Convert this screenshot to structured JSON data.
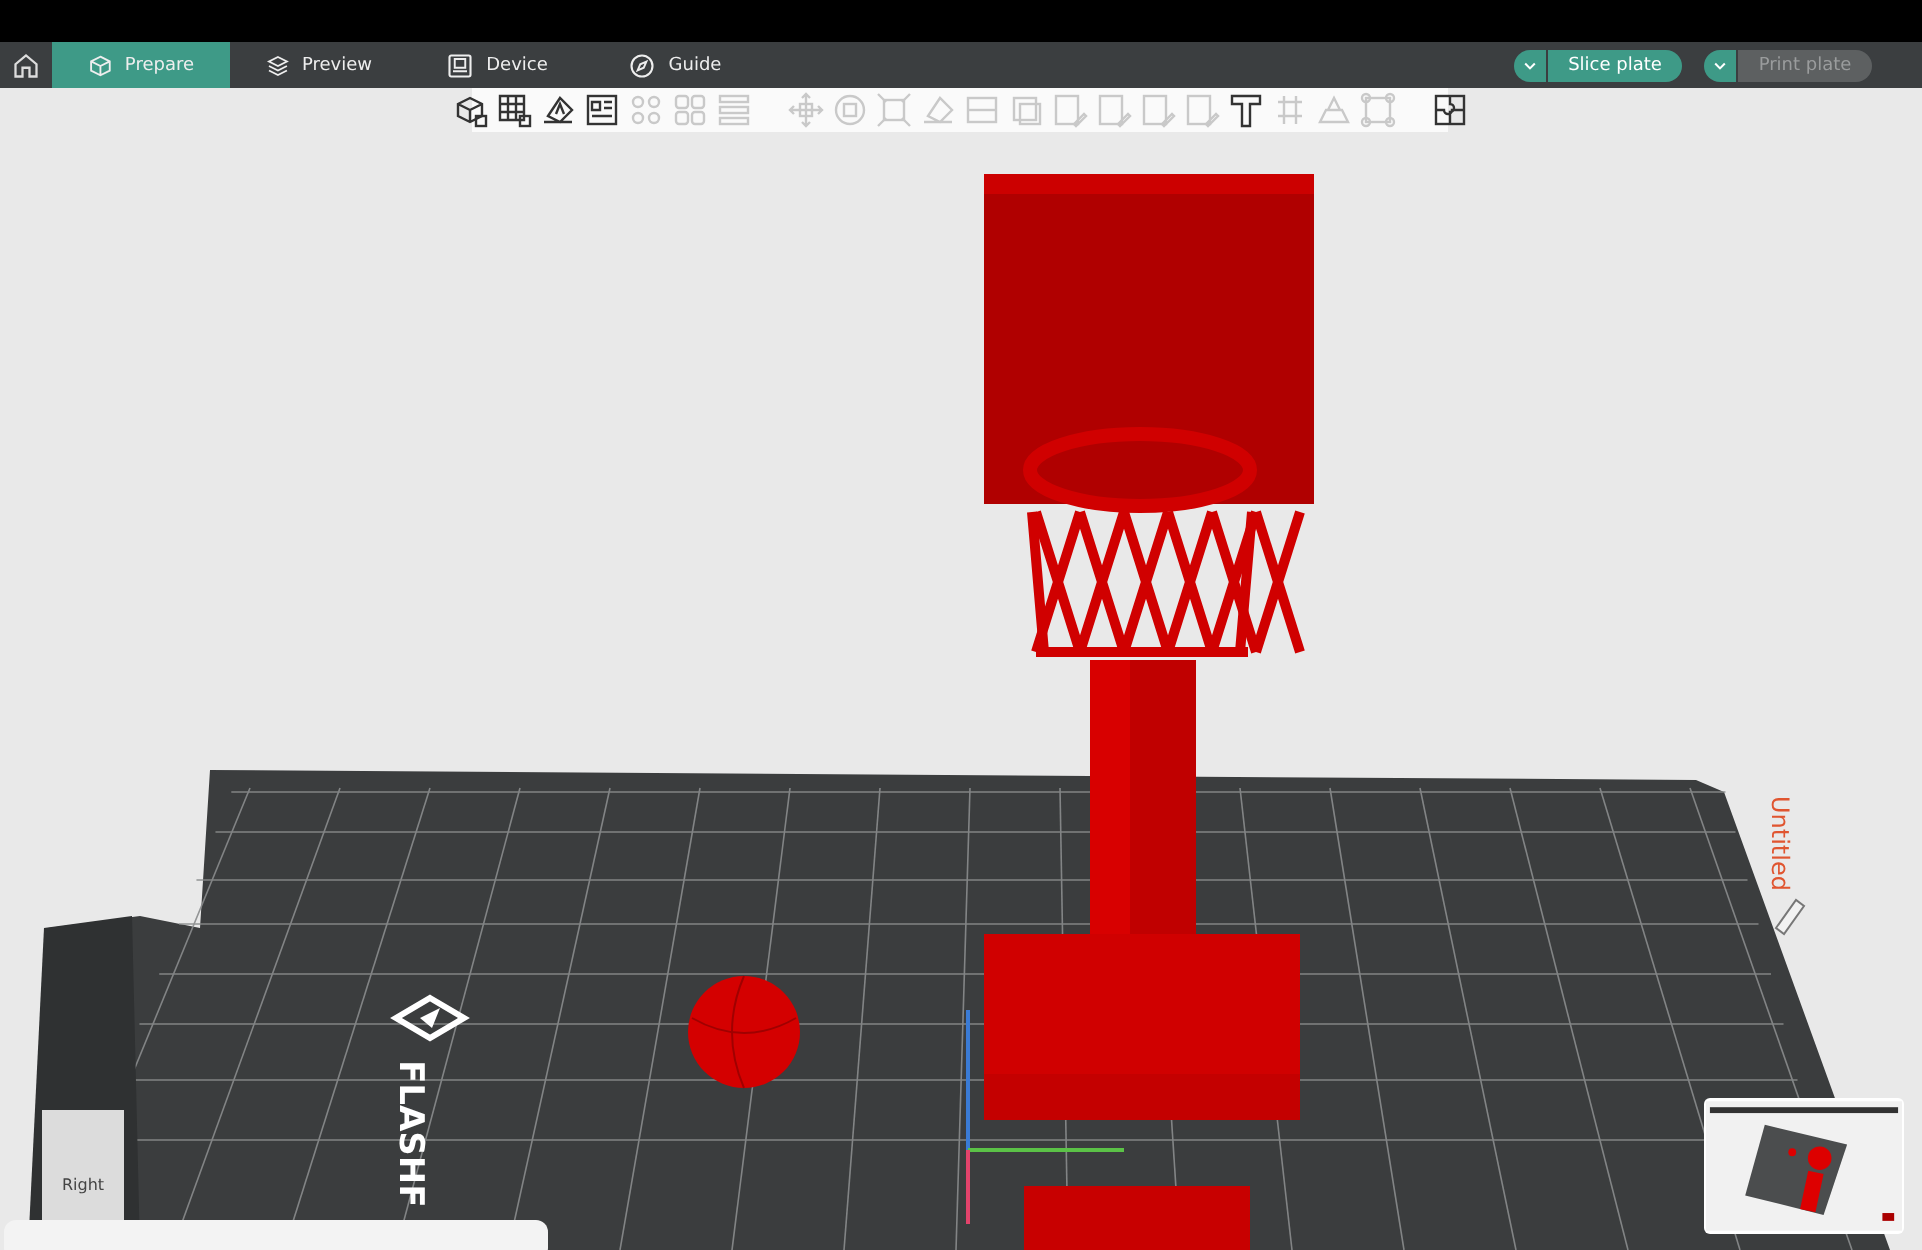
{
  "tabs": [
    {
      "kind": "prepare",
      "label": "Prepare",
      "selected": true
    },
    {
      "kind": "preview",
      "label": "Preview",
      "selected": false
    },
    {
      "kind": "device",
      "label": "Device",
      "selected": false
    },
    {
      "kind": "guide",
      "label": "Guide",
      "selected": false
    }
  ],
  "actions": [
    {
      "label": "Slice plate",
      "disabled": false
    },
    {
      "label": "Print plate",
      "disabled": true
    }
  ],
  "toolbar": [
    {
      "kind": "add",
      "disabled": false
    },
    {
      "kind": "plate",
      "disabled": false
    },
    {
      "kind": "orient",
      "disabled": false
    },
    {
      "kind": "arrange",
      "disabled": false
    },
    {
      "kind": "dots",
      "disabled": true
    },
    {
      "kind": "squares",
      "disabled": true
    },
    {
      "kind": "lines",
      "disabled": true
    },
    {
      "kind": "sep"
    },
    {
      "kind": "move",
      "disabled": true
    },
    {
      "kind": "rotate",
      "disabled": true
    },
    {
      "kind": "scale",
      "disabled": true
    },
    {
      "kind": "flatten",
      "disabled": true
    },
    {
      "kind": "cut",
      "disabled": true
    },
    {
      "kind": "box",
      "disabled": true
    },
    {
      "kind": "paint",
      "disabled": true
    },
    {
      "kind": "paint",
      "disabled": true
    },
    {
      "kind": "paint",
      "disabled": true
    },
    {
      "kind": "paint",
      "disabled": true
    },
    {
      "kind": "text",
      "disabled": false
    },
    {
      "kind": "measure",
      "disabled": true
    },
    {
      "kind": "emboss",
      "disabled": true
    },
    {
      "kind": "assembly",
      "disabled": true
    },
    {
      "kind": "sep"
    },
    {
      "kind": "puzzle",
      "disabled": false
    }
  ],
  "scene": {
    "bed_logo": "FLASHF",
    "plate_name": "Untitled",
    "view_cube": {
      "label": "Right"
    }
  }
}
